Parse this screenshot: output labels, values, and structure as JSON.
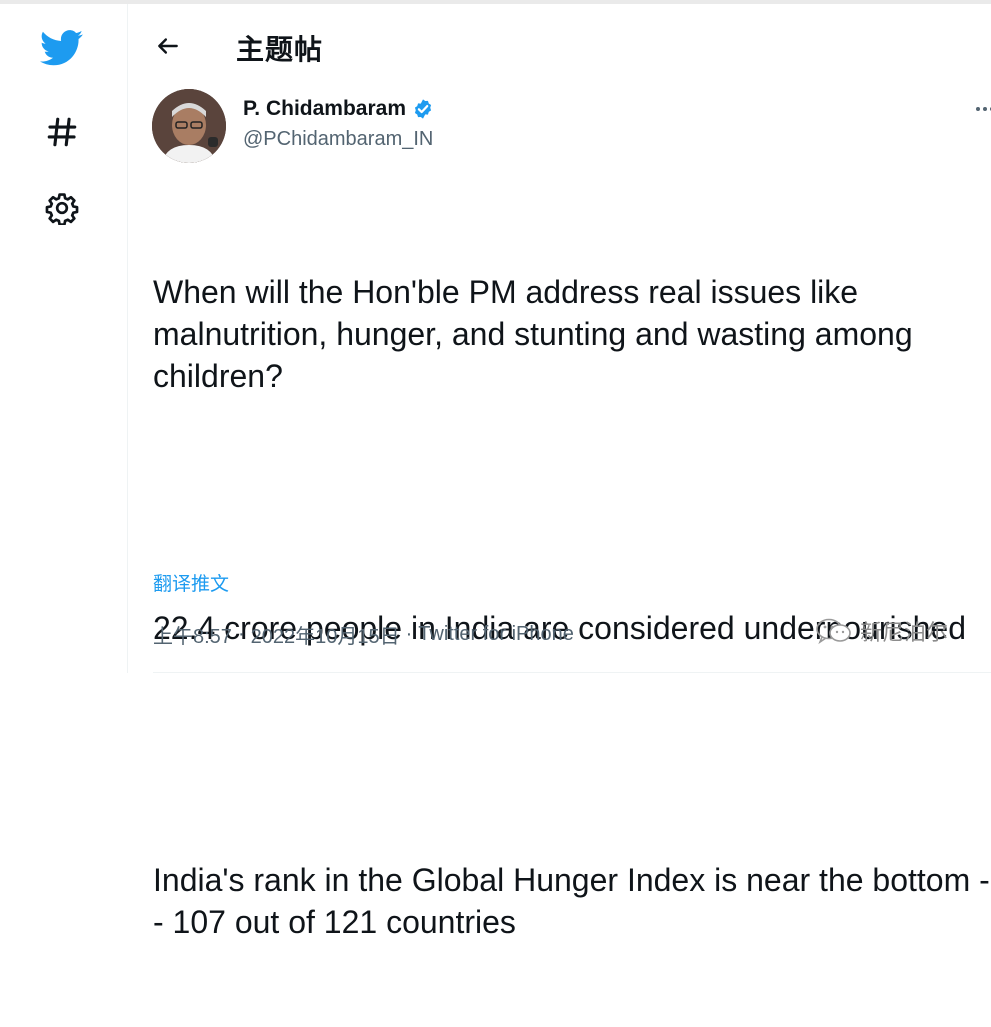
{
  "colors": {
    "brand": "#1d9bf0",
    "text": "#0f1419",
    "muted": "#536471",
    "watermark": "#8c8c8c"
  },
  "sidebar": {
    "items": [
      {
        "icon": "twitter-bird-icon"
      },
      {
        "icon": "hashtag-icon"
      },
      {
        "icon": "gear-icon"
      }
    ]
  },
  "header": {
    "back_icon": "arrow-left-icon",
    "title": "主题帖"
  },
  "tweet": {
    "author": {
      "name": "P. Chidambaram",
      "handle": "@PChidambaram_IN",
      "verified": true
    },
    "paragraphs": [
      "When will the Hon'ble PM address real issues like malnutrition, hunger, and stunting and wasting among children?",
      "22.4 crore people in India are considered undernourished",
      "India's rank in the Global Hunger Index is near the bottom -- 107 out of 121 countries"
    ],
    "translate_label": "翻译推文",
    "time": "上午8:57",
    "date": "2022年10月15日",
    "source": "Twitter for iPhone",
    "separator": "·"
  },
  "watermark": {
    "icon": "wechat-icon",
    "text": "新尼泊尔"
  }
}
